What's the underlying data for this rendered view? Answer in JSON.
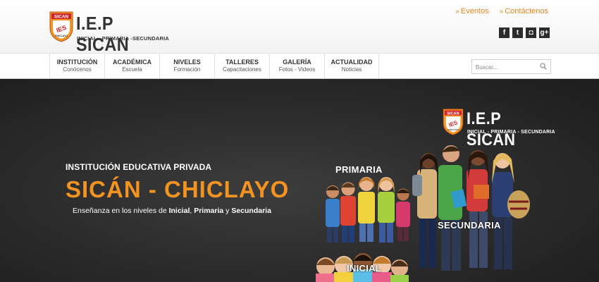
{
  "brand": {
    "shield_top": "SICAN",
    "shield_mid": "IES",
    "shield_bottom": "CHICLAYO",
    "name": "I.E.P SICAN",
    "tagline": "INICIAL - PRIMARIA -SECUNDARIA"
  },
  "top_links": [
    {
      "label": "Eventos"
    },
    {
      "label": "Contáctenos"
    }
  ],
  "social": [
    {
      "icon": "facebook-icon",
      "glyph": "f"
    },
    {
      "icon": "twitter-icon",
      "glyph": "t"
    },
    {
      "icon": "instagram-icon",
      "glyph": "◘"
    },
    {
      "icon": "google-plus-icon",
      "glyph": "g+"
    }
  ],
  "nav": [
    {
      "title": "INSTITUCIÓN",
      "subtitle": "Conócenos"
    },
    {
      "title": "ACADÉMICA",
      "subtitle": "Escuela"
    },
    {
      "title": "NIVELES",
      "subtitle": "Formación"
    },
    {
      "title": "TALLERES",
      "subtitle": "Capacitaciones"
    },
    {
      "title": "GALERÍA",
      "subtitle": "Fotos - Videos"
    },
    {
      "title": "ACTUALIDAD",
      "subtitle": "Noticias"
    }
  ],
  "search": {
    "placeholder": "Buscar..."
  },
  "hero": {
    "kicker": "INSTITUCIÓN EDUCATIVA PRIVADA",
    "title": "SICÁN - CHICLAYO",
    "desc_prefix": "Enseñanza en los niveles de ",
    "desc_inicial": "Inicial",
    "desc_sep": ", ",
    "desc_primaria": "Primaria",
    "desc_y": " y ",
    "desc_secundaria": "Secundaria",
    "logo_name": "I.E.P SICAN",
    "logo_tagline": "INICIAL - PRIMARIA - SECUNDARIA",
    "label_primaria": "PRIMARIA",
    "label_secundaria": "SECUNDARIA",
    "label_inicial": "INICIAL"
  },
  "colors": {
    "accent": "#f39321",
    "link": "#e3851c",
    "dark": "#2a2a2a",
    "shield_red": "#d2232a"
  }
}
